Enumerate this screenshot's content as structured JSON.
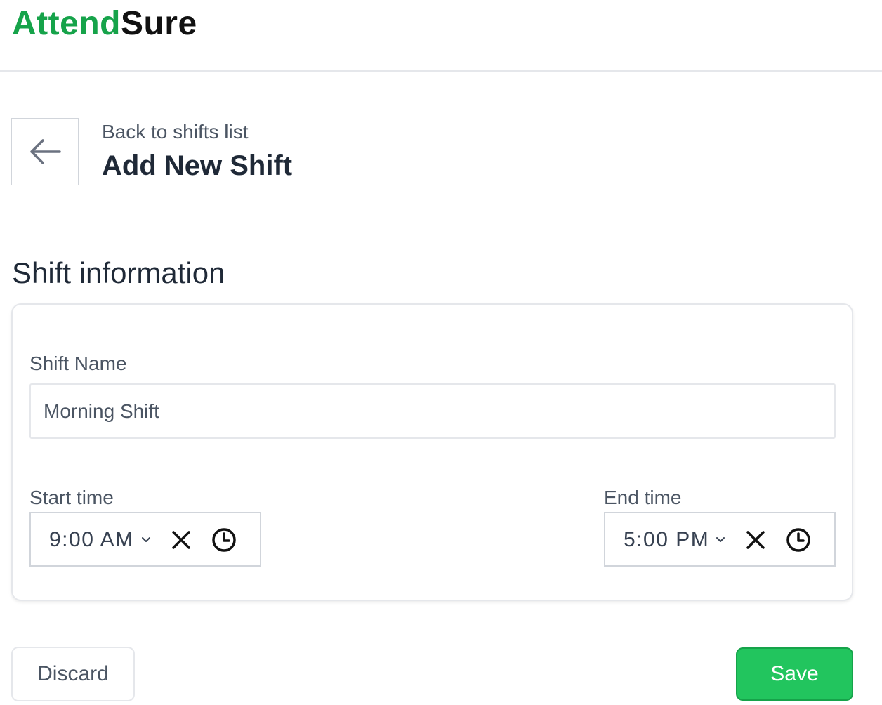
{
  "brand": {
    "name_part1": "Attend",
    "name_part2": "Sure",
    "color_part1": "#16a34a",
    "color_part2": "#111111"
  },
  "header": {
    "back_link": "Back to shifts list",
    "title": "Add New Shift",
    "back_icon": "arrow-left-icon"
  },
  "section": {
    "title": "Shift information"
  },
  "form": {
    "shift_name_label": "Shift Name",
    "shift_name_value": "Morning Shift",
    "start_time_label": "Start time",
    "start_time_value": "9:00 AM",
    "end_time_label": "End time",
    "end_time_value": "5:00 PM",
    "icons": [
      "chevron-down-icon",
      "close-icon",
      "clock-icon"
    ]
  },
  "actions": {
    "discard_label": "Discard",
    "save_label": "Save",
    "save_color": "#22c55e"
  }
}
